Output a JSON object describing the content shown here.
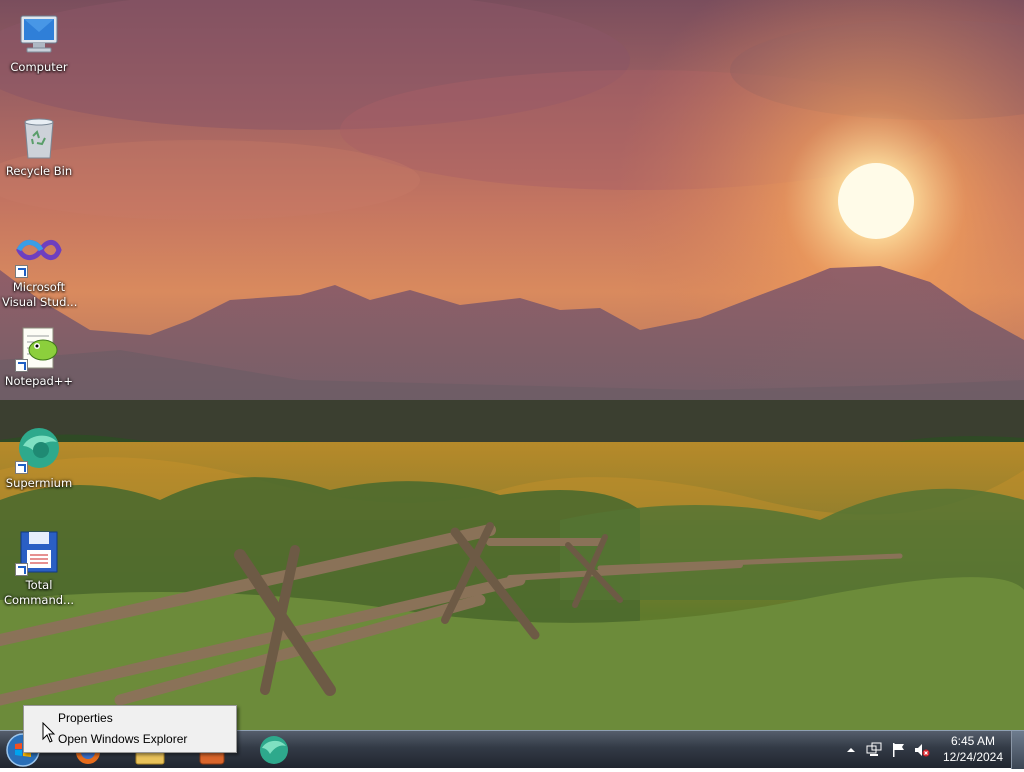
{
  "desktop": {
    "icons": [
      {
        "name": "computer",
        "label": "Computer"
      },
      {
        "name": "recycle-bin",
        "label": "Recycle Bin"
      },
      {
        "name": "visual-studio",
        "label_line1": "Microsoft",
        "label_line2": "Visual Stud..."
      },
      {
        "name": "notepad-plus-plus",
        "label": "Notepad++"
      },
      {
        "name": "supermium",
        "label": "Supermium"
      },
      {
        "name": "total-commander",
        "label_line1": "Total",
        "label_line2": "Command..."
      }
    ]
  },
  "context_menu": {
    "items": [
      "Properties",
      "Open Windows Explorer"
    ]
  },
  "taskbar": {
    "pinned": [
      "firefox-like",
      "windows-explorer",
      "media",
      "supermium"
    ],
    "clock": {
      "time": "6:45 AM",
      "date": "12/24/2024"
    },
    "tray_icons": [
      "show-hidden-icons",
      "network-icon",
      "action-center-flag-icon",
      "volume-muted-icon"
    ]
  }
}
